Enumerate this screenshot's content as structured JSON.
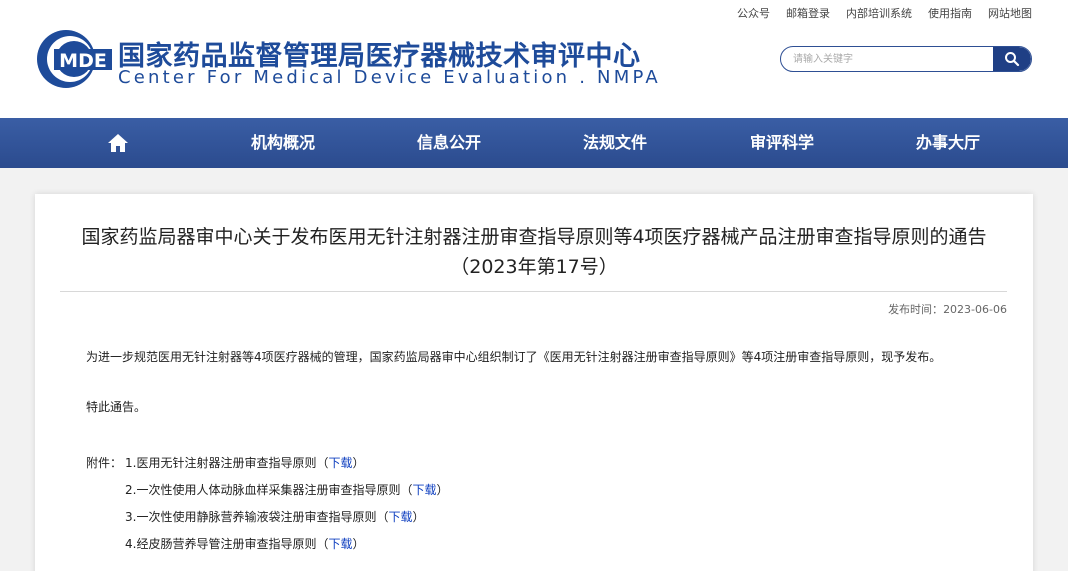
{
  "top_links": [
    "公众号",
    "邮箱登录",
    "内部培训系统",
    "使用指南",
    "网站地图"
  ],
  "logo": {
    "mark_text": "MDE",
    "name_cn": "国家药品监督管理局医疗器械技术审评中心",
    "name_en": "Center For Medical Device Evaluation . NMPA"
  },
  "search": {
    "placeholder": "请输入关键字"
  },
  "nav": [
    "机构概况",
    "信息公开",
    "法规文件",
    "审评科学",
    "办事大厅"
  ],
  "article": {
    "title": "国家药监局器审中心关于发布医用无针注射器注册审查指导原则等4项医疗器械产品注册审查指导原则的通告（2023年第17号）",
    "date_label": "发布时间：",
    "date": "2023-06-06",
    "body": "为进一步规范医用无针注射器等4项医疗器械的管理，国家药监局器审中心组织制订了《医用无针注射器注册审查指导原则》等4项注册审查指导原则，现予发布。",
    "notice": "特此通告。",
    "attachment_label": "附件：",
    "attachments": [
      {
        "name": "1.医用无针注射器注册审查指导原则（",
        "link": "下载",
        "close": "）"
      },
      {
        "name": "2.一次性使用人体动脉血样采集器注册审查指导原则（",
        "link": "下载",
        "close": "）"
      },
      {
        "name": "3.一次性使用静脉营养输液袋注册审查指导原则（",
        "link": "下载",
        "close": "）"
      },
      {
        "name": "4.经皮肠营养导管注册审查指导原则（",
        "link": "下载",
        "close": "）"
      }
    ]
  },
  "colors": {
    "brand": "#1e4b9a",
    "nav": "#2b4b8e",
    "link": "#1040c0"
  }
}
